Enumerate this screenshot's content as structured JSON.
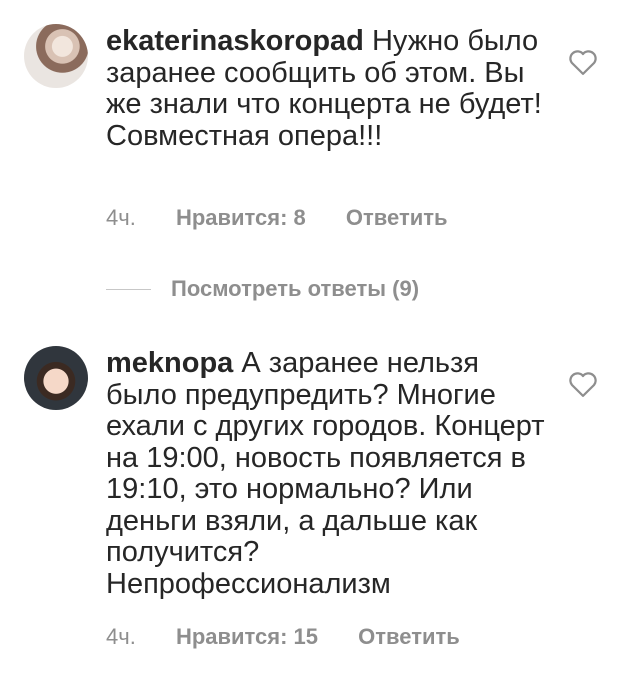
{
  "comments": [
    {
      "username": "ekaterinaskoropad",
      "text": "Нужно было заранее сообщить об этом. Вы же знали что концерта не будет! Совместная опера!!!",
      "time": "4ч.",
      "likes": "Нравится: 8",
      "reply_label": "Ответить"
    },
    {
      "username": "meknopa",
      "text": "А заранее нельзя было предупредить? Многие ехали с других городов. Концерт на 19:00, новость появляется в 19:10, это нормально? Или деньги взяли, а дальше как получится? Непрофессионализм",
      "time": "4ч.",
      "likes": "Нравится: 15",
      "reply_label": "Ответить"
    }
  ],
  "view_replies": {
    "label": "Посмотреть ответы (9)"
  },
  "icons": {
    "avatar": "avatar",
    "like": "heart-outline-icon"
  },
  "colors": {
    "text": "#262626",
    "secondary": "#8e8e8e",
    "divider": "#c7c7c7"
  }
}
